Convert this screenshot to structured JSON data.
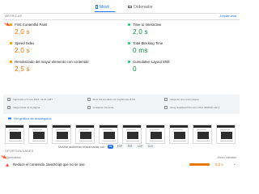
{
  "tabs": [
    {
      "label": "Móvil",
      "active": true,
      "icon": "mobile-icon"
    },
    {
      "label": "Ordenador",
      "active": false,
      "icon": "desktop-icon"
    }
  ],
  "metrics_section": {
    "title": "MÉTRICAS",
    "side_link": "Ampliar vista",
    "items": [
      {
        "label": "First Contentful Paint",
        "value": "2,0 s",
        "status": "average",
        "shape": "square"
      },
      {
        "label": "Time to Interactive",
        "value": "2,0 s",
        "status": "good",
        "shape": "circle"
      },
      {
        "label": "Speed Index",
        "value": "2,0 s",
        "status": "average",
        "shape": "square"
      },
      {
        "label": "Total Blocking Time",
        "value": "0 ms",
        "status": "good",
        "shape": "circle"
      },
      {
        "label": "Renderizado del mayor elemento con contenido",
        "value": "2,5 s",
        "status": "average",
        "shape": "square"
      },
      {
        "label": "Cumulative Layout Shift",
        "value": "0",
        "status": "good",
        "shape": "circle"
      }
    ]
  },
  "info": [
    {
      "text": "Capturado el 3 nov 2021, 13:21 GMT",
      "icon": "calendar-icon"
    },
    {
      "text": "Moto G4 emulado con Lighthouse 8.6.0",
      "icon": "device-icon"
    },
    {
      "text": "Carga de una única página",
      "icon": "page-icon"
    },
    {
      "text": "Carga inicial de la página",
      "icon": "timer-icon"
    },
    {
      "text": "Limitación 4G lenta",
      "icon": "network-icon"
    },
    {
      "text": "Using HeadlessChromium 95.0.4638.69 with lr",
      "icon": "browser-icon"
    }
  ],
  "treemap_link": "Ver gráfico de rectángulos",
  "filter": {
    "label": "Mostrar auditorías relacionadas con:",
    "chips": [
      "All",
      "FCP",
      "TBT",
      "LCP",
      "CLS"
    ],
    "selected": "All"
  },
  "opportunities": {
    "title": "OPORTUNIDADES",
    "col_left": "Oportunidad",
    "col_right": "Ahorro estimado",
    "items": [
      {
        "label": "Reduce el contenido JavaScript que no se use",
        "savings": "0,3 s"
      }
    ]
  },
  "colors": {
    "accent": "#1a73e8",
    "average": "#ffa400",
    "good": "#0cce6b",
    "fail": "#ff4e42"
  }
}
